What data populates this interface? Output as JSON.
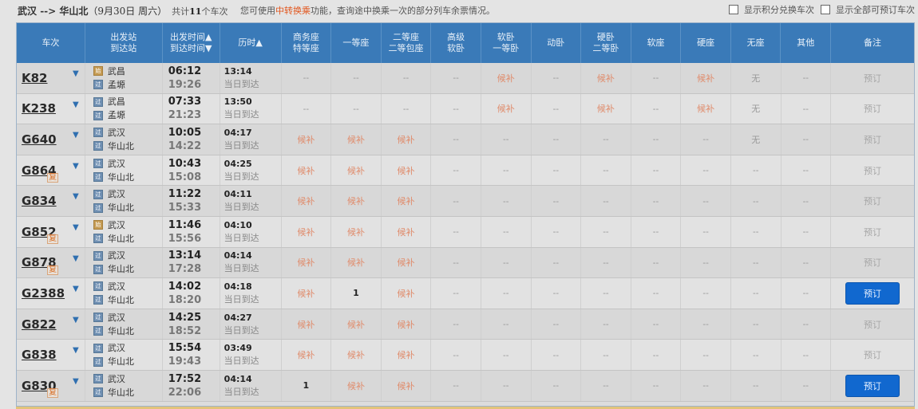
{
  "header": {
    "from": "武汉",
    "arrow": " --> ",
    "to": "华山北",
    "date": "（9月30日  周六）",
    "count_prefix": "共计",
    "count": "11",
    "count_suffix": "个车次",
    "hint_pre": "您可使用",
    "hint_link": "中转换乘",
    "hint_post": "功能，查询途中换乘一次的部分列车余票情况。",
    "opt1": "显示积分兑换车次",
    "opt2": "显示全部可预订车次"
  },
  "columns": [
    [
      "车次"
    ],
    [
      "出发站",
      "到达站"
    ],
    [
      "出发时间▲",
      "到达时间▼"
    ],
    [
      "历时▲"
    ],
    [
      "商务座",
      "特等座"
    ],
    [
      "一等座"
    ],
    [
      "二等座",
      "二等包座"
    ],
    [
      "高级",
      "软卧"
    ],
    [
      "软卧",
      "一等卧"
    ],
    [
      "动卧"
    ],
    [
      "硬卧",
      "二等卧"
    ],
    [
      "软座"
    ],
    [
      "硬座"
    ],
    [
      "无座"
    ],
    [
      "其他"
    ],
    [
      "备注"
    ]
  ],
  "rows": [
    {
      "train": "K82",
      "fu": false,
      "from": "武昌",
      "to": "孟塬",
      "from_icon": "始",
      "to_icon": "过",
      "dep": "06:12",
      "arr": "19:26",
      "dur": "13:14",
      "day": "当日到达",
      "seats": [
        "--",
        "--",
        "--",
        "--",
        "候补",
        "--",
        "候补",
        "--",
        "候补",
        "无",
        "--"
      ],
      "note": "预订",
      "bookable": false
    },
    {
      "train": "K238",
      "fu": false,
      "from": "武昌",
      "to": "孟塬",
      "from_icon": "过",
      "to_icon": "过",
      "dep": "07:33",
      "arr": "21:23",
      "dur": "13:50",
      "day": "当日到达",
      "seats": [
        "--",
        "--",
        "--",
        "--",
        "候补",
        "--",
        "候补",
        "--",
        "候补",
        "无",
        "--"
      ],
      "note": "预订",
      "bookable": false
    },
    {
      "train": "G640",
      "fu": false,
      "from": "武汉",
      "to": "华山北",
      "from_icon": "过",
      "to_icon": "过",
      "dep": "10:05",
      "arr": "14:22",
      "dur": "04:17",
      "day": "当日到达",
      "seats": [
        "候补",
        "候补",
        "候补",
        "--",
        "--",
        "--",
        "--",
        "--",
        "--",
        "无",
        "--"
      ],
      "note": "预订",
      "bookable": false
    },
    {
      "train": "G864",
      "fu": true,
      "from": "武汉",
      "to": "华山北",
      "from_icon": "过",
      "to_icon": "过",
      "dep": "10:43",
      "arr": "15:08",
      "dur": "04:25",
      "day": "当日到达",
      "seats": [
        "候补",
        "候补",
        "候补",
        "--",
        "--",
        "--",
        "--",
        "--",
        "--",
        "--",
        "--"
      ],
      "note": "预订",
      "bookable": false
    },
    {
      "train": "G834",
      "fu": false,
      "from": "武汉",
      "to": "华山北",
      "from_icon": "过",
      "to_icon": "过",
      "dep": "11:22",
      "arr": "15:33",
      "dur": "04:11",
      "day": "当日到达",
      "seats": [
        "候补",
        "候补",
        "候补",
        "--",
        "--",
        "--",
        "--",
        "--",
        "--",
        "--",
        "--"
      ],
      "note": "预订",
      "bookable": false
    },
    {
      "train": "G852",
      "fu": true,
      "from": "武汉",
      "to": "华山北",
      "from_icon": "始",
      "to_icon": "过",
      "dep": "11:46",
      "arr": "15:56",
      "dur": "04:10",
      "day": "当日到达",
      "seats": [
        "候补",
        "候补",
        "候补",
        "--",
        "--",
        "--",
        "--",
        "--",
        "--",
        "--",
        "--"
      ],
      "note": "预订",
      "bookable": false
    },
    {
      "train": "G878",
      "fu": true,
      "from": "武汉",
      "to": "华山北",
      "from_icon": "过",
      "to_icon": "过",
      "dep": "13:14",
      "arr": "17:28",
      "dur": "04:14",
      "day": "当日到达",
      "seats": [
        "候补",
        "候补",
        "候补",
        "--",
        "--",
        "--",
        "--",
        "--",
        "--",
        "--",
        "--"
      ],
      "note": "预订",
      "bookable": false
    },
    {
      "train": "G2388",
      "fu": false,
      "from": "武汉",
      "to": "华山北",
      "from_icon": "过",
      "to_icon": "过",
      "dep": "14:02",
      "arr": "18:20",
      "dur": "04:18",
      "day": "当日到达",
      "seats": [
        "候补",
        "1",
        "候补",
        "--",
        "--",
        "--",
        "--",
        "--",
        "--",
        "--",
        "--"
      ],
      "note": "预订",
      "bookable": true
    },
    {
      "train": "G822",
      "fu": false,
      "from": "武汉",
      "to": "华山北",
      "from_icon": "过",
      "to_icon": "过",
      "dep": "14:25",
      "arr": "18:52",
      "dur": "04:27",
      "day": "当日到达",
      "seats": [
        "候补",
        "候补",
        "候补",
        "--",
        "--",
        "--",
        "--",
        "--",
        "--",
        "--",
        "--"
      ],
      "note": "预订",
      "bookable": false
    },
    {
      "train": "G838",
      "fu": false,
      "from": "武汉",
      "to": "华山北",
      "from_icon": "过",
      "to_icon": "过",
      "dep": "15:54",
      "arr": "19:43",
      "dur": "03:49",
      "day": "当日到达",
      "seats": [
        "候补",
        "候补",
        "候补",
        "--",
        "--",
        "--",
        "--",
        "--",
        "--",
        "--",
        "--"
      ],
      "note": "预订",
      "bookable": false
    },
    {
      "train": "G830",
      "fu": true,
      "from": "武汉",
      "to": "华山北",
      "from_icon": "过",
      "to_icon": "过",
      "dep": "17:52",
      "arr": "22:06",
      "dur": "04:14",
      "day": "当日到达",
      "seats": [
        "1",
        "候补",
        "候补",
        "--",
        "--",
        "--",
        "--",
        "--",
        "--",
        "--",
        "--"
      ],
      "note": "预订",
      "bookable": true
    }
  ],
  "fu_label": "复"
}
